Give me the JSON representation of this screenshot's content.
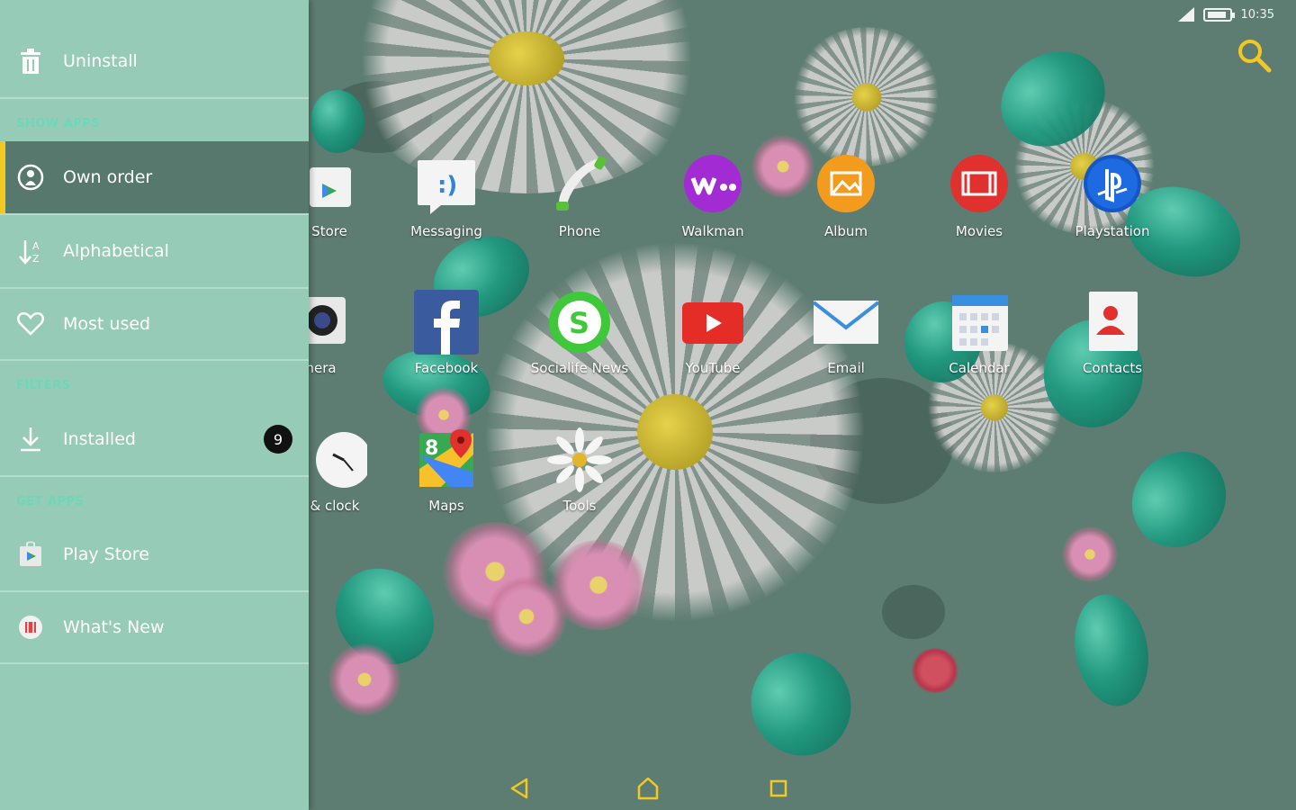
{
  "status_bar": {
    "time": "10:35"
  },
  "drawer": {
    "uninstall_label": "Uninstall",
    "sections": {
      "show_apps": "SHOW APPS",
      "filters": "FILTERS",
      "get_apps": "GET APPS"
    },
    "items": {
      "own_order": "Own order",
      "alphabetical": "Alphabetical",
      "most_used": "Most used",
      "installed": "Installed",
      "installed_count": "9",
      "play_store": "Play Store",
      "whats_new": "What's New"
    },
    "colors": {
      "background": "#96cbb7",
      "selected": "#57786c",
      "accent": "#f3c820"
    }
  },
  "apps": {
    "row1": [
      "Store",
      "Messaging",
      "Phone",
      "Walkman",
      "Album",
      "Movies",
      "Playstation"
    ],
    "row2": [
      "mera",
      "Facebook",
      "Socialife News",
      "YouTube",
      "Email",
      "Calendar",
      "Contacts"
    ],
    "row3": [
      "& clock",
      "Maps",
      "Tools"
    ]
  },
  "icons": {
    "search": "search-icon",
    "back": "back-icon",
    "home": "home-icon",
    "recents": "recents-icon"
  },
  "accent_color": "#f3c820"
}
